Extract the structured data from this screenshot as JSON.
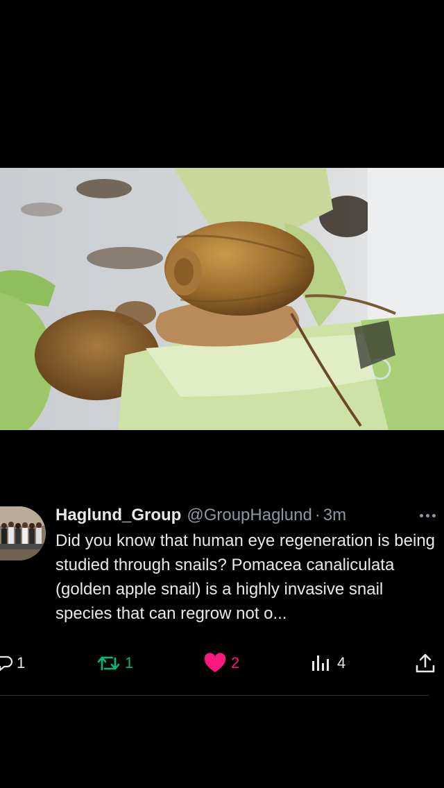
{
  "media": {
    "description_icon": "snail-photo"
  },
  "tweet": {
    "display_name": "Haglund_Group",
    "handle": "@GroupHaglund",
    "separator": "·",
    "time": "3m",
    "text": "Did you know that human eye regeneration is being studied through snails? Pomacea canaliculata (golden apple snail) is a highly invasive snail species that can regrow not o..."
  },
  "actions": {
    "reply_count": "1",
    "retweet_count": "1",
    "like_count": "2",
    "views_count": "4"
  },
  "colors": {
    "background": "#000000",
    "text": "#e7e9ea",
    "secondary": "#8b98a5",
    "retweet": "#00ba7c",
    "like": "#f91880"
  }
}
